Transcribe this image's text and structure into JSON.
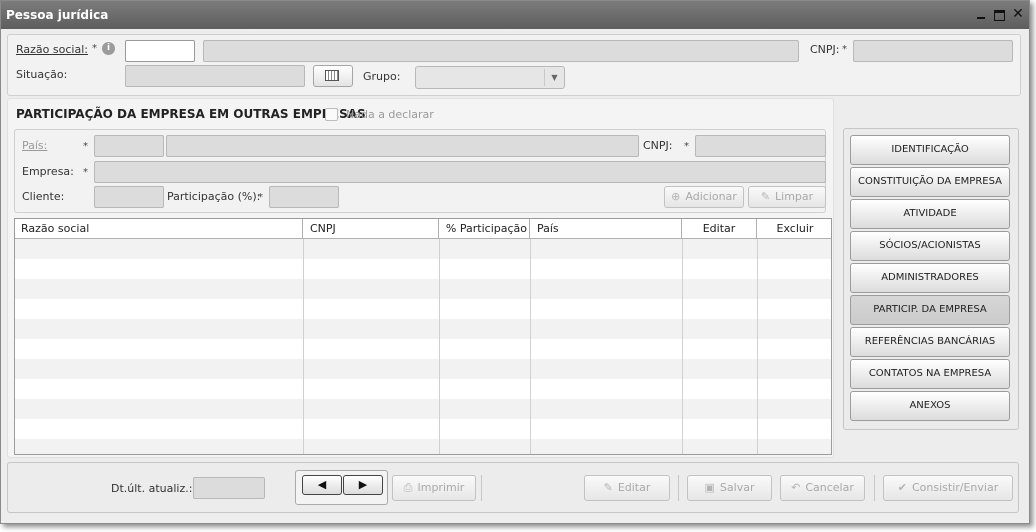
{
  "window": {
    "title": "Pessoa jurídica"
  },
  "top_form": {
    "razao_social_label": "Razão social:",
    "cnpj_label": "CNPJ:",
    "situacao_label": "Situação:",
    "grupo_label": "Grupo:",
    "required_mark": "*",
    "info_icon": "i"
  },
  "section": {
    "title": "PARTICIPAÇÃO DA EMPRESA EM OUTRAS EMPRESAS",
    "nada_a_declarar": "Nada a declarar"
  },
  "participation_form": {
    "pais_label": "País:",
    "cnpj_label": "CNPJ:",
    "empresa_label": "Empresa:",
    "cliente_label": "Cliente:",
    "participacao_label": "Participação (%):",
    "adicionar": "Adicionar",
    "limpar": "Limpar"
  },
  "grid": {
    "columns": [
      "Razão social",
      "CNPJ",
      "% Participação",
      "País",
      "Editar",
      "Excluir"
    ],
    "rows": []
  },
  "nav": {
    "items": [
      "IDENTIFICAÇÃO",
      "CONSTITUIÇÃO DA EMPRESA",
      "ATIVIDADE",
      "SÓCIOS/ACIONISTAS",
      "ADMINISTRADORES",
      "PARTICIP. DA EMPRESA",
      "REFERÊNCIAS BANCÁRIAS",
      "CONTATOS NA EMPRESA",
      "ANEXOS"
    ],
    "active_index": 5
  },
  "footer": {
    "dt_ult_atualiz_label": "Dt.últ. atualiz.:",
    "prev": "◀",
    "next": "▶",
    "imprimir": "Imprimir",
    "editar": "Editar",
    "salvar": "Salvar",
    "cancelar": "Cancelar",
    "consistir_enviar": "Consistir/Enviar"
  },
  "colors": {
    "titlebar": "#6a6a6a",
    "panel": "#f2f2f2",
    "field": "#dcdcdc",
    "disabled_text": "#a9a9a9"
  }
}
